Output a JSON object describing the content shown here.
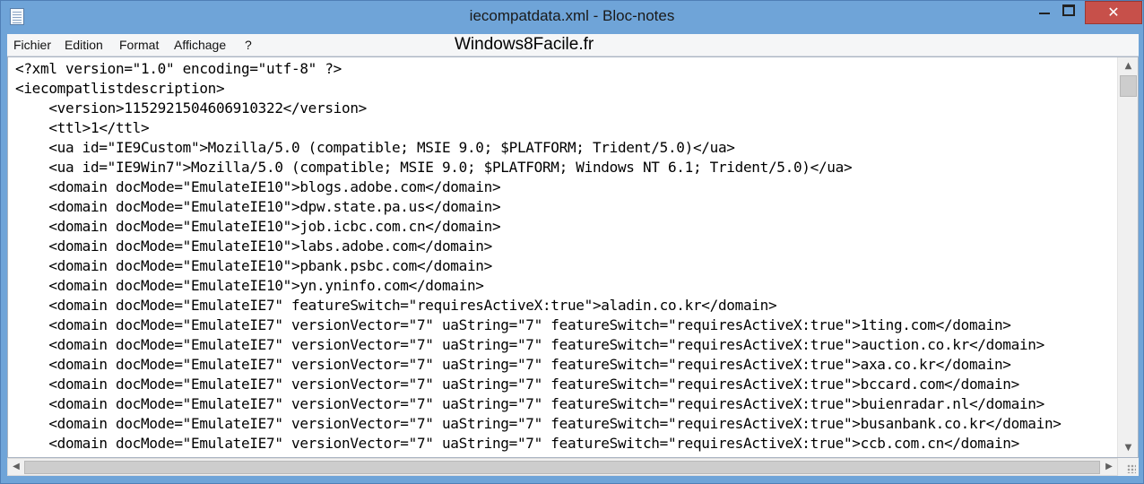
{
  "window": {
    "title": "iecompatdata.xml - Bloc-notes",
    "close_glyph": "✕"
  },
  "menu": {
    "items": [
      "Fichier",
      "Edition",
      "Format",
      "Affichage",
      "?"
    ]
  },
  "watermark": "Windows8Facile.fr",
  "document": {
    "lines": [
      "<?xml version=\"1.0\" encoding=\"utf-8\" ?>",
      "<iecompatlistdescription>",
      "    <version>1152921504606910322</version>",
      "    <ttl>1</ttl>",
      "    <ua id=\"IE9Custom\">Mozilla/5.0 (compatible; MSIE 9.0; $PLATFORM; Trident/5.0)</ua>",
      "    <ua id=\"IE9Win7\">Mozilla/5.0 (compatible; MSIE 9.0; $PLATFORM; Windows NT 6.1; Trident/5.0)</ua>",
      "    <domain docMode=\"EmulateIE10\">blogs.adobe.com</domain>",
      "    <domain docMode=\"EmulateIE10\">dpw.state.pa.us</domain>",
      "    <domain docMode=\"EmulateIE10\">job.icbc.com.cn</domain>",
      "    <domain docMode=\"EmulateIE10\">labs.adobe.com</domain>",
      "    <domain docMode=\"EmulateIE10\">pbank.psbc.com</domain>",
      "    <domain docMode=\"EmulateIE10\">yn.yninfo.com</domain>",
      "    <domain docMode=\"EmulateIE7\" featureSwitch=\"requiresActiveX:true\">aladin.co.kr</domain>",
      "    <domain docMode=\"EmulateIE7\" versionVector=\"7\" uaString=\"7\" featureSwitch=\"requiresActiveX:true\">1ting.com</domain>",
      "    <domain docMode=\"EmulateIE7\" versionVector=\"7\" uaString=\"7\" featureSwitch=\"requiresActiveX:true\">auction.co.kr</domain>",
      "    <domain docMode=\"EmulateIE7\" versionVector=\"7\" uaString=\"7\" featureSwitch=\"requiresActiveX:true\">axa.co.kr</domain>",
      "    <domain docMode=\"EmulateIE7\" versionVector=\"7\" uaString=\"7\" featureSwitch=\"requiresActiveX:true\">bccard.com</domain>",
      "    <domain docMode=\"EmulateIE7\" versionVector=\"7\" uaString=\"7\" featureSwitch=\"requiresActiveX:true\">buienradar.nl</domain>",
      "    <domain docMode=\"EmulateIE7\" versionVector=\"7\" uaString=\"7\" featureSwitch=\"requiresActiveX:true\">busanbank.co.kr</domain>",
      "    <domain docMode=\"EmulateIE7\" versionVector=\"7\" uaString=\"7\" featureSwitch=\"requiresActiveX:true\">ccb.com.cn</domain>"
    ]
  },
  "icons": {
    "app": "notepad-icon",
    "minimize": "minimize-icon",
    "maximize": "maximize-icon",
    "close": "close-icon",
    "scroll_up": "arrow-up-icon",
    "scroll_down": "arrow-down-icon",
    "scroll_left": "arrow-left-icon",
    "scroll_right": "arrow-right-icon",
    "grip": "resize-grip-icon"
  },
  "colors": {
    "frame": "#6fa4d8",
    "close_button": "#c7504a"
  }
}
